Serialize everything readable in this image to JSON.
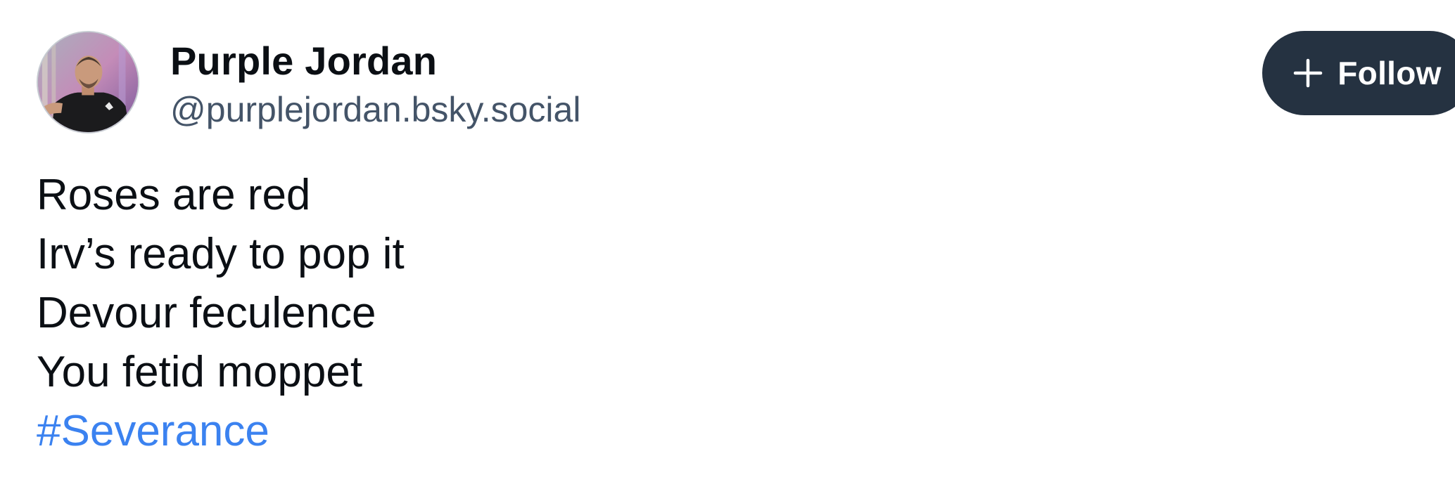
{
  "post": {
    "author": {
      "display_name": "Purple Jordan",
      "handle": "@purplejordan.bsky.social",
      "avatar_icon": "avatar-photo"
    },
    "follow_button": {
      "icon": "plus-icon",
      "label": "Follow"
    },
    "text_lines": [
      "Roses are red",
      "Irv’s ready to pop it",
      "Devour feculence",
      "You fetid moppet"
    ],
    "hashtag": "#Severance"
  },
  "colors": {
    "follow_button_bg": "#253241",
    "handle_text": "#445468",
    "hashtag_link": "#3b82f0",
    "body_text": "#0b0f14"
  }
}
